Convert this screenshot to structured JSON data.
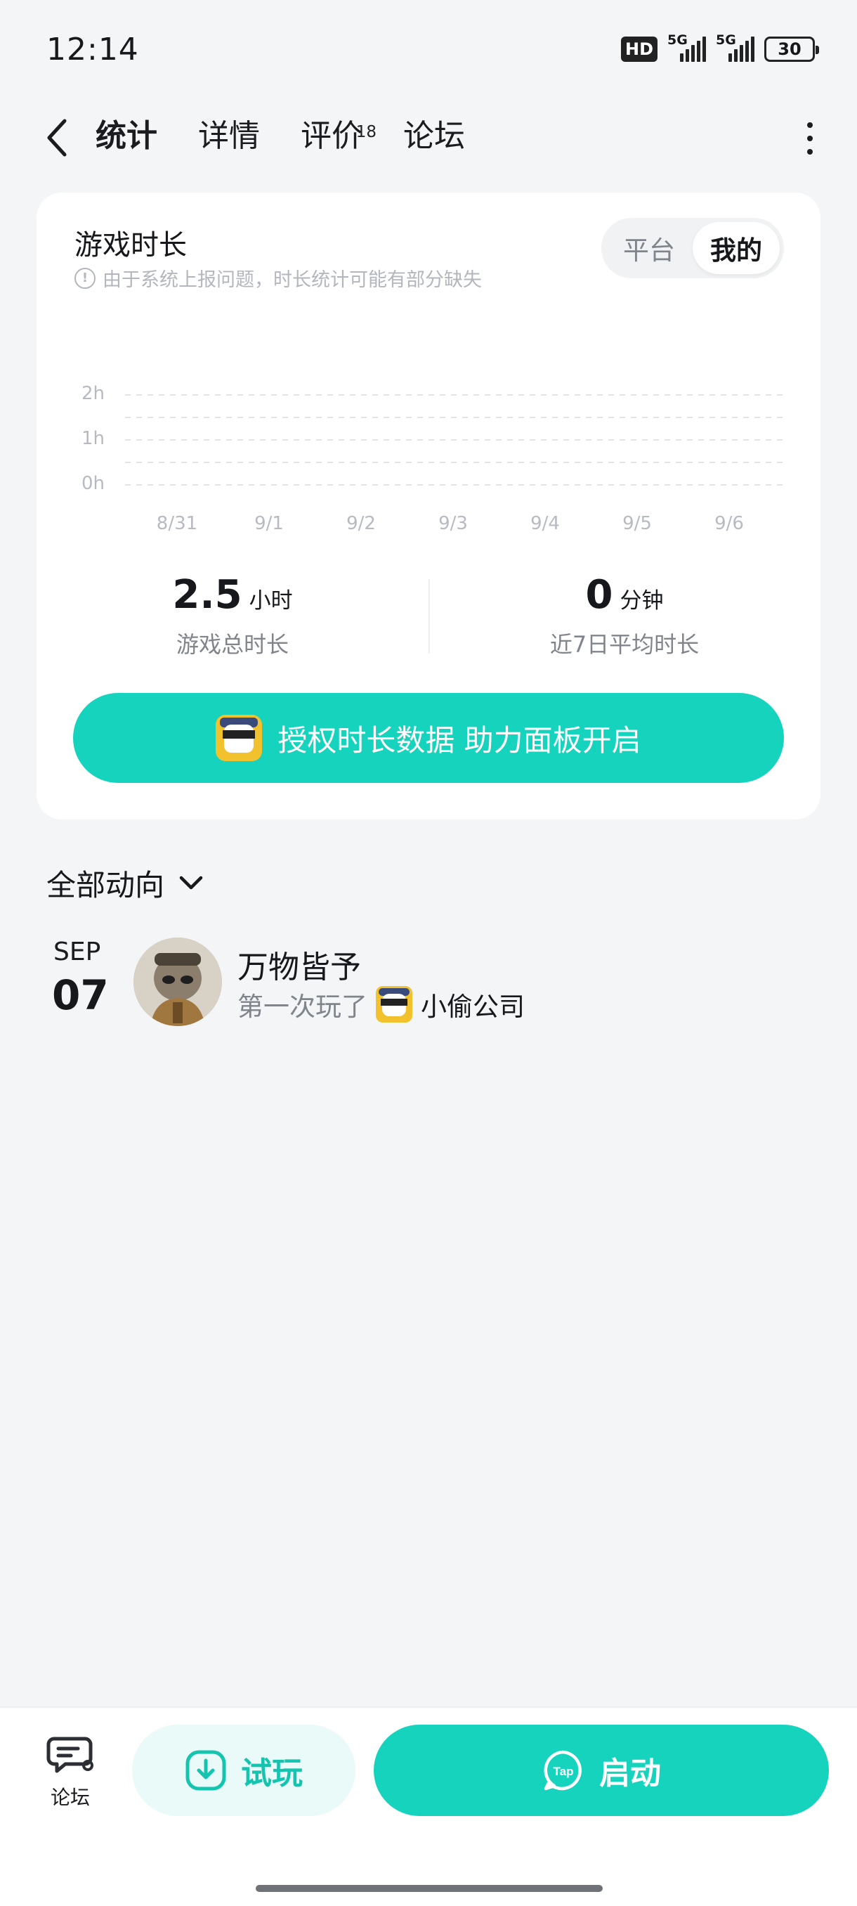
{
  "status_bar": {
    "time": "12:14",
    "hd_label": "HD",
    "network_1": "5G",
    "network_2": "5G",
    "battery": "30"
  },
  "nav": {
    "tabs": [
      {
        "label": "统计",
        "active": true
      },
      {
        "label": "详情",
        "active": false
      },
      {
        "label": "评价",
        "active": false,
        "badge": "18"
      },
      {
        "label": "论坛",
        "active": false
      }
    ]
  },
  "playtime_card": {
    "title": "游戏时长",
    "note": "由于系统上报问题，时长统计可能有部分缺失",
    "segment": {
      "options": [
        "平台",
        "我的"
      ],
      "selected": "我的"
    },
    "stats": [
      {
        "value": "2.5",
        "unit": "小时",
        "label": "游戏总时长"
      },
      {
        "value": "0",
        "unit": "分钟",
        "label": "近7日平均时长"
      }
    ],
    "auth_button": "授权时长数据 助力面板开启"
  },
  "chart_data": {
    "type": "bar",
    "categories": [
      "8/31",
      "9/1",
      "9/2",
      "9/3",
      "9/4",
      "9/5",
      "9/6"
    ],
    "values": [
      0,
      0,
      0,
      0,
      0,
      0,
      0
    ],
    "y_ticks": [
      "2h",
      "1h",
      "0h"
    ],
    "ylim": [
      0,
      2
    ],
    "grid": true
  },
  "activity": {
    "header": "全部动向",
    "items": [
      {
        "month": "SEP",
        "day": "07",
        "user": "万物皆予",
        "verb": "第一次玩了",
        "game": "小偷公司"
      }
    ]
  },
  "bottom_bar": {
    "forum_label": "论坛",
    "trial_label": "试玩",
    "launch_label": "启动",
    "launch_icon_text": "Tap"
  },
  "colors": {
    "accent": "#15d3bd",
    "background": "#f4f5f7",
    "muted_text": "#80858c"
  }
}
